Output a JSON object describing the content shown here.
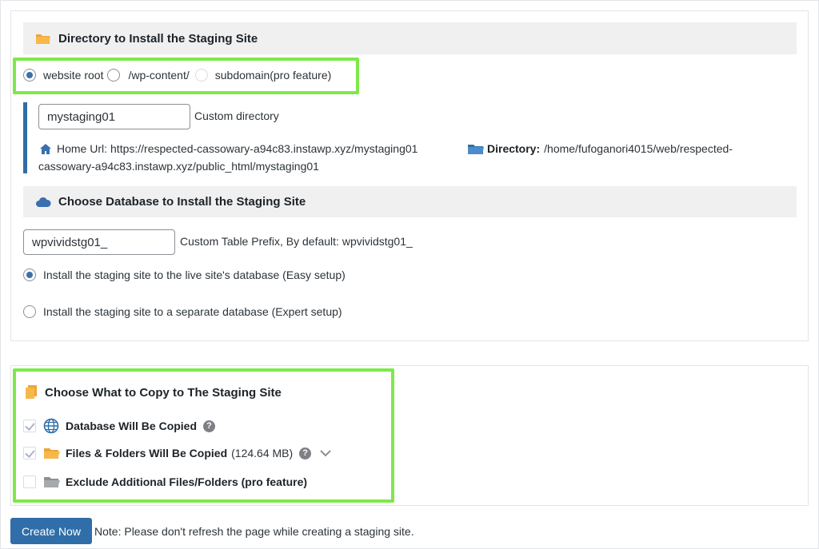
{
  "directory_section": {
    "title": "Directory to Install the Staging Site",
    "options": [
      "website root",
      "/wp-content/",
      "subdomain(pro feature)"
    ],
    "selected": "website root",
    "custom_dir_value": "mystaging01",
    "custom_dir_label": "Custom directory",
    "home_url_label": "Home Url:",
    "home_url_value": "https://respected-cassowary-a94c83.instawp.xyz/mystaging01",
    "directory_label": "Directory:",
    "directory_value_part1": "/home/fufoganori4015/web/respected-",
    "directory_value_part2": "cassowary-a94c83.instawp.xyz/public_html/mystaging01"
  },
  "database_section": {
    "title": "Choose Database to Install the Staging Site",
    "prefix_value": "wpvividstg01_",
    "prefix_label": "Custom Table Prefix, By default: wpvividstg01_",
    "option_easy": "Install the staging site to the live site's database (Easy setup)",
    "option_expert": "Install the staging site to a separate database (Expert setup)",
    "selected": "easy"
  },
  "copy_section": {
    "title": "Choose What to Copy to The Staging Site",
    "items": [
      {
        "label": "Database Will Be Copied",
        "extra": "",
        "checked": true,
        "icon": "globe-icon"
      },
      {
        "label": "Files & Folders Will Be Copied",
        "extra": "(124.64 MB)",
        "checked": true,
        "icon": "open-folder-icon"
      },
      {
        "label": "Exclude Additional Files/Folders (pro feature)",
        "extra": "",
        "checked": false,
        "icon": "gray-folder-icon"
      }
    ],
    "help_glyph": "?"
  },
  "footer": {
    "create_button": "Create Now",
    "note": "Note: Please don't refresh the page while creating a staging site."
  },
  "colors": {
    "accent_blue": "#2f6ea8",
    "highlight_green": "#7ee84b",
    "folder_orange": "#f5a623"
  }
}
